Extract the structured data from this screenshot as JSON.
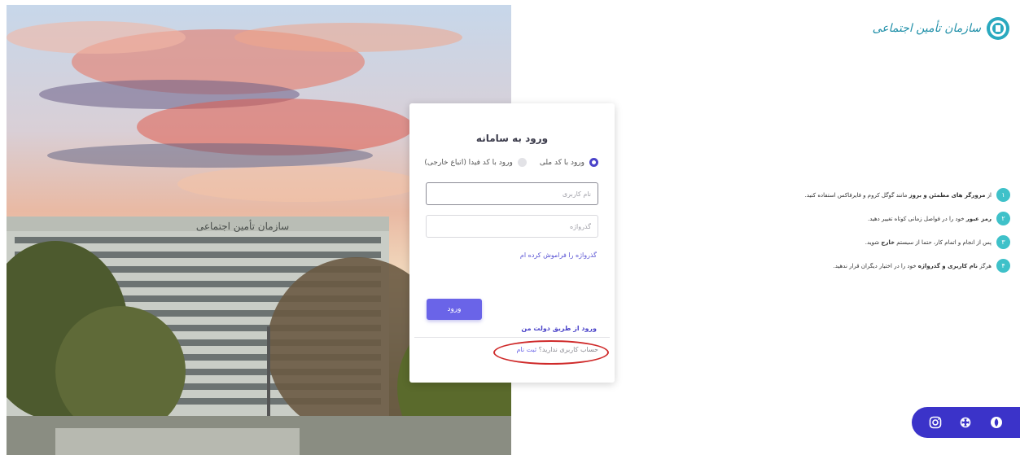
{
  "logo": {
    "text": "سازمان تأمین اجتماعی",
    "color": "#1f8fa8"
  },
  "photo": {
    "building_sign": "سازمان تأمین اجتماعی"
  },
  "login": {
    "title": "ورود به سامانه",
    "radio_national_code": "ورود با کد ملی",
    "radio_fida_code": "ورود با کد فیدا (اتباع خارجی)",
    "selected_radio": "national_code",
    "username_placeholder": "نام کاربری",
    "password_placeholder": "گذرواژه",
    "forgot_password": "گذرواژه را فراموش کرده ام",
    "submit_label": "ورود",
    "dolat_login": "ورود از طریق دولت من",
    "no_account": "حساب کاربری ندارید؟",
    "register": "ثبت نام",
    "accent_color": "#6a64e8"
  },
  "tips": [
    {
      "num": "۱",
      "parts": [
        {
          "t": "از ",
          "b": false
        },
        {
          "t": "مرورگر های مطمئن و بروز",
          "b": true
        },
        {
          "t": " مانند گوگل کروم و فایرفاکس استفاده کنید.",
          "b": false
        }
      ]
    },
    {
      "num": "۲",
      "parts": [
        {
          "t": "رمز عبور",
          "b": true
        },
        {
          "t": " خود را در فواصل زمانی کوتاه تغییر دهید.",
          "b": false
        }
      ]
    },
    {
      "num": "۳",
      "parts": [
        {
          "t": "پس از انجام و اتمام کار، حتما از سیستم ",
          "b": false
        },
        {
          "t": "خارج",
          "b": true
        },
        {
          "t": " شوید.",
          "b": false
        }
      ]
    },
    {
      "num": "۴",
      "parts": [
        {
          "t": "هرگز ",
          "b": false
        },
        {
          "t": "نام کاربری و گذرواژه",
          "b": true
        },
        {
          "t": " خود را در اختیار دیگران قرار ندهید.",
          "b": false
        }
      ]
    }
  ],
  "tips_badge_color": "#3fc1c9",
  "social": {
    "bar_color": "#3b33c9",
    "icons": [
      "app-icon",
      "aparat-icon",
      "instagram-icon"
    ]
  }
}
